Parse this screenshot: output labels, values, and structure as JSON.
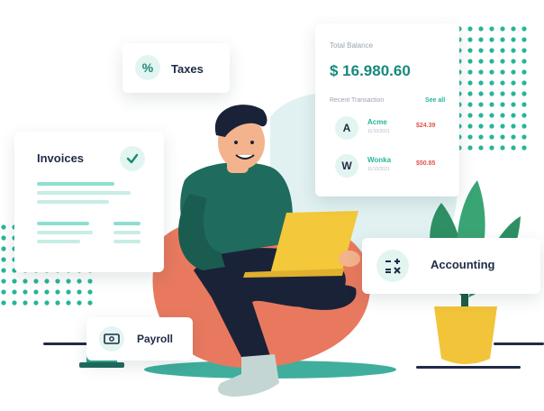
{
  "colors": {
    "accent": "#2bb59a",
    "dots": "#27b597",
    "text_dark": "#1f2b46",
    "amount_red": "#e0544b",
    "beanbag": "#e8795f",
    "sweater": "#1f6b5d",
    "laptop": "#f3c83a",
    "pot": "#f2c43a",
    "leaf": "#2e8f64"
  },
  "taxes_card": {
    "icon": "percent-icon",
    "label": "Taxes"
  },
  "invoices_card": {
    "title": "Invoices",
    "icon": "check-icon"
  },
  "balance_card": {
    "total_label": "Total Balance",
    "total_value": "$ 16.980.60",
    "recent_label": "Recent Transaction",
    "see_all": "See all",
    "transactions": [
      {
        "initial": "A",
        "name": "Acme",
        "date": "11/10/2021",
        "amount": "$24.39"
      },
      {
        "initial": "W",
        "name": "Wonka",
        "date": "11/10/2021",
        "amount": "$50.85"
      }
    ]
  },
  "accounting_card": {
    "icon": "calculator-icon",
    "label": "Accounting"
  },
  "payroll_card": {
    "icon": "cash-icon",
    "label": "Payroll"
  }
}
